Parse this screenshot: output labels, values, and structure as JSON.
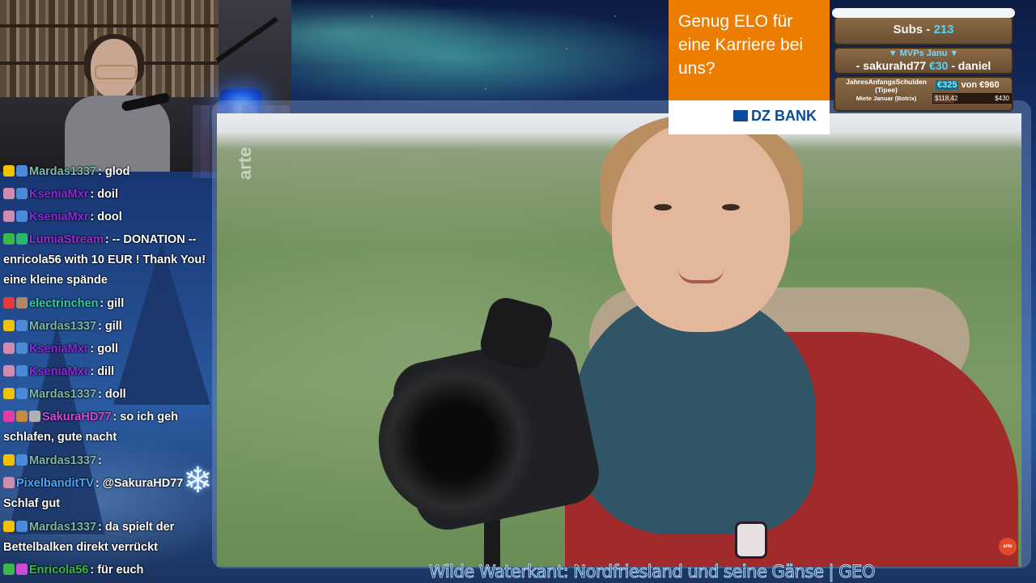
{
  "stream": {
    "video_caption": "Wilde Waterkant: Nordfriesland und seine Gänse | GEO",
    "watermark": "arte",
    "corner_logo": "arte"
  },
  "ad": {
    "headline": "Genug ELO für eine Karriere bei uns?",
    "brand": "DZ BANK"
  },
  "panel": {
    "subs_label": "Subs - ",
    "subs_count": "213",
    "mvp_label": "▼ MVPs Janu ▼",
    "mvp_prefix": "- sakurahd77 ",
    "mvp_amount": "€30",
    "mvp_suffix": " - daniel",
    "debt_label": "JahresAnfangsSchulden (Tipee)",
    "debt_current": "€325",
    "debt_rest": " von €960",
    "rent_label": "Miete Januar (Botrix)",
    "rent_current": "$118,42",
    "rent_max": "$430",
    "rent_fraction": 0.275
  },
  "chat": {
    "messages": [
      {
        "user": "Mardas1337",
        "color": "#7fb7a8",
        "badge_colors": [
          "#f2c200",
          "#4a8ad8"
        ],
        "text": ": glod"
      },
      {
        "user": "KseniaMxr",
        "color": "#8a2be2",
        "badge_colors": [
          "#d28ab0",
          "#4a8ad8"
        ],
        "text": ": doil"
      },
      {
        "user": "KseniaMxr",
        "color": "#8a2be2",
        "badge_colors": [
          "#d28ab0",
          "#4a8ad8"
        ],
        "text": ": dool"
      },
      {
        "user": "LumiaStream",
        "color": "#9b2bd8",
        "badge_colors": [
          "#3ab84a",
          "#2ab86a"
        ],
        "text": ": -- DONATION -- enricola56 with 10 EUR ! Thank You! eine kleine spände"
      },
      {
        "user": "electrinchen",
        "color": "#2fd0a8",
        "badge_colors": [
          "#e83a3a",
          "#b08868"
        ],
        "text": ": gill"
      },
      {
        "user": "Mardas1337",
        "color": "#7fb7a8",
        "badge_colors": [
          "#f2c200",
          "#4a8ad8"
        ],
        "text": ": gill"
      },
      {
        "user": "KseniaMxr",
        "color": "#8a2be2",
        "badge_colors": [
          "#d28ab0",
          "#4a8ad8"
        ],
        "text": ": goll"
      },
      {
        "user": "KseniaMxr",
        "color": "#8a2be2",
        "badge_colors": [
          "#d28ab0",
          "#4a8ad8"
        ],
        "text": ": dill"
      },
      {
        "user": "Mardas1337",
        "color": "#7fb7a8",
        "badge_colors": [
          "#f2c200",
          "#4a8ad8"
        ],
        "text": ": doll"
      },
      {
        "user": "SakuraHD77",
        "color": "#d24ad8",
        "badge_colors": [
          "#e83aa8",
          "#c88a3a",
          "#b0b0b0"
        ],
        "text": ": so ich geh schlafen, gute nacht"
      },
      {
        "user": "Mardas1337",
        "color": "#7fb7a8",
        "badge_colors": [
          "#f2c200",
          "#4a8ad8"
        ],
        "text": ":"
      },
      {
        "user": "PixelbanditTV",
        "color": "#4aa8f8",
        "badge_colors": [
          "#d28ab0"
        ],
        "text": ": @SakuraHD77 Schlaf gut"
      },
      {
        "user": "Mardas1337",
        "color": "#7fb7a8",
        "badge_colors": [
          "#f2c200",
          "#4a8ad8"
        ],
        "text": ": da spielt der Bettelbalken direkt verrückt"
      },
      {
        "user": "Enricola56",
        "color": "#3ab84a",
        "badge_colors": [
          "#3ab84a",
          "#d24ad8"
        ],
        "text": ": für euch"
      }
    ]
  }
}
